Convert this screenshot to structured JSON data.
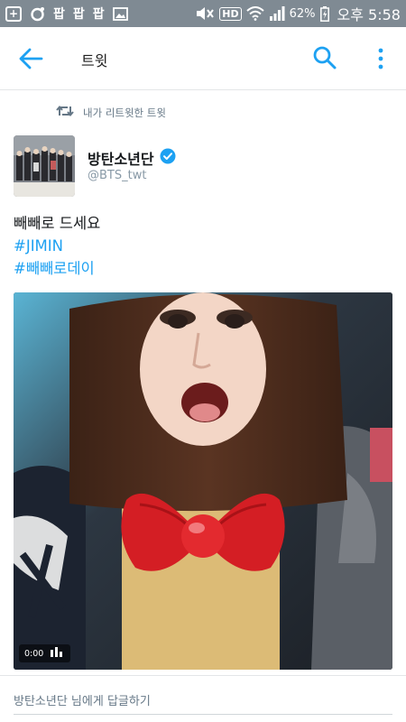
{
  "status_bar": {
    "notif_icons": [
      "add-box-icon",
      "circle-o-icon",
      "kakao-talk-icon",
      "kakao-talk-icon",
      "kakao-talk-icon",
      "image-icon"
    ],
    "carrier_glyph": "팝",
    "hd": "HD",
    "battery": "62%",
    "clock": "오후 5:58"
  },
  "app_bar": {
    "title": "트윗"
  },
  "tweet": {
    "retweet_context": "내가 리트윗한 트윗",
    "author_name": "방탄소년단",
    "author_handle": "@BTS_twt",
    "text_line": "빼빼로 드세요",
    "hashtags": [
      "#JIMIN",
      "#빼빼로데이"
    ],
    "video_time": "0:00"
  },
  "reply": {
    "placeholder": "방탄소년단 님에게 답글하기"
  },
  "colors": {
    "accent": "#1da1f2",
    "status_bar": "#7f8a93",
    "verified": "#1da1f2",
    "muted_text": "#657786"
  }
}
